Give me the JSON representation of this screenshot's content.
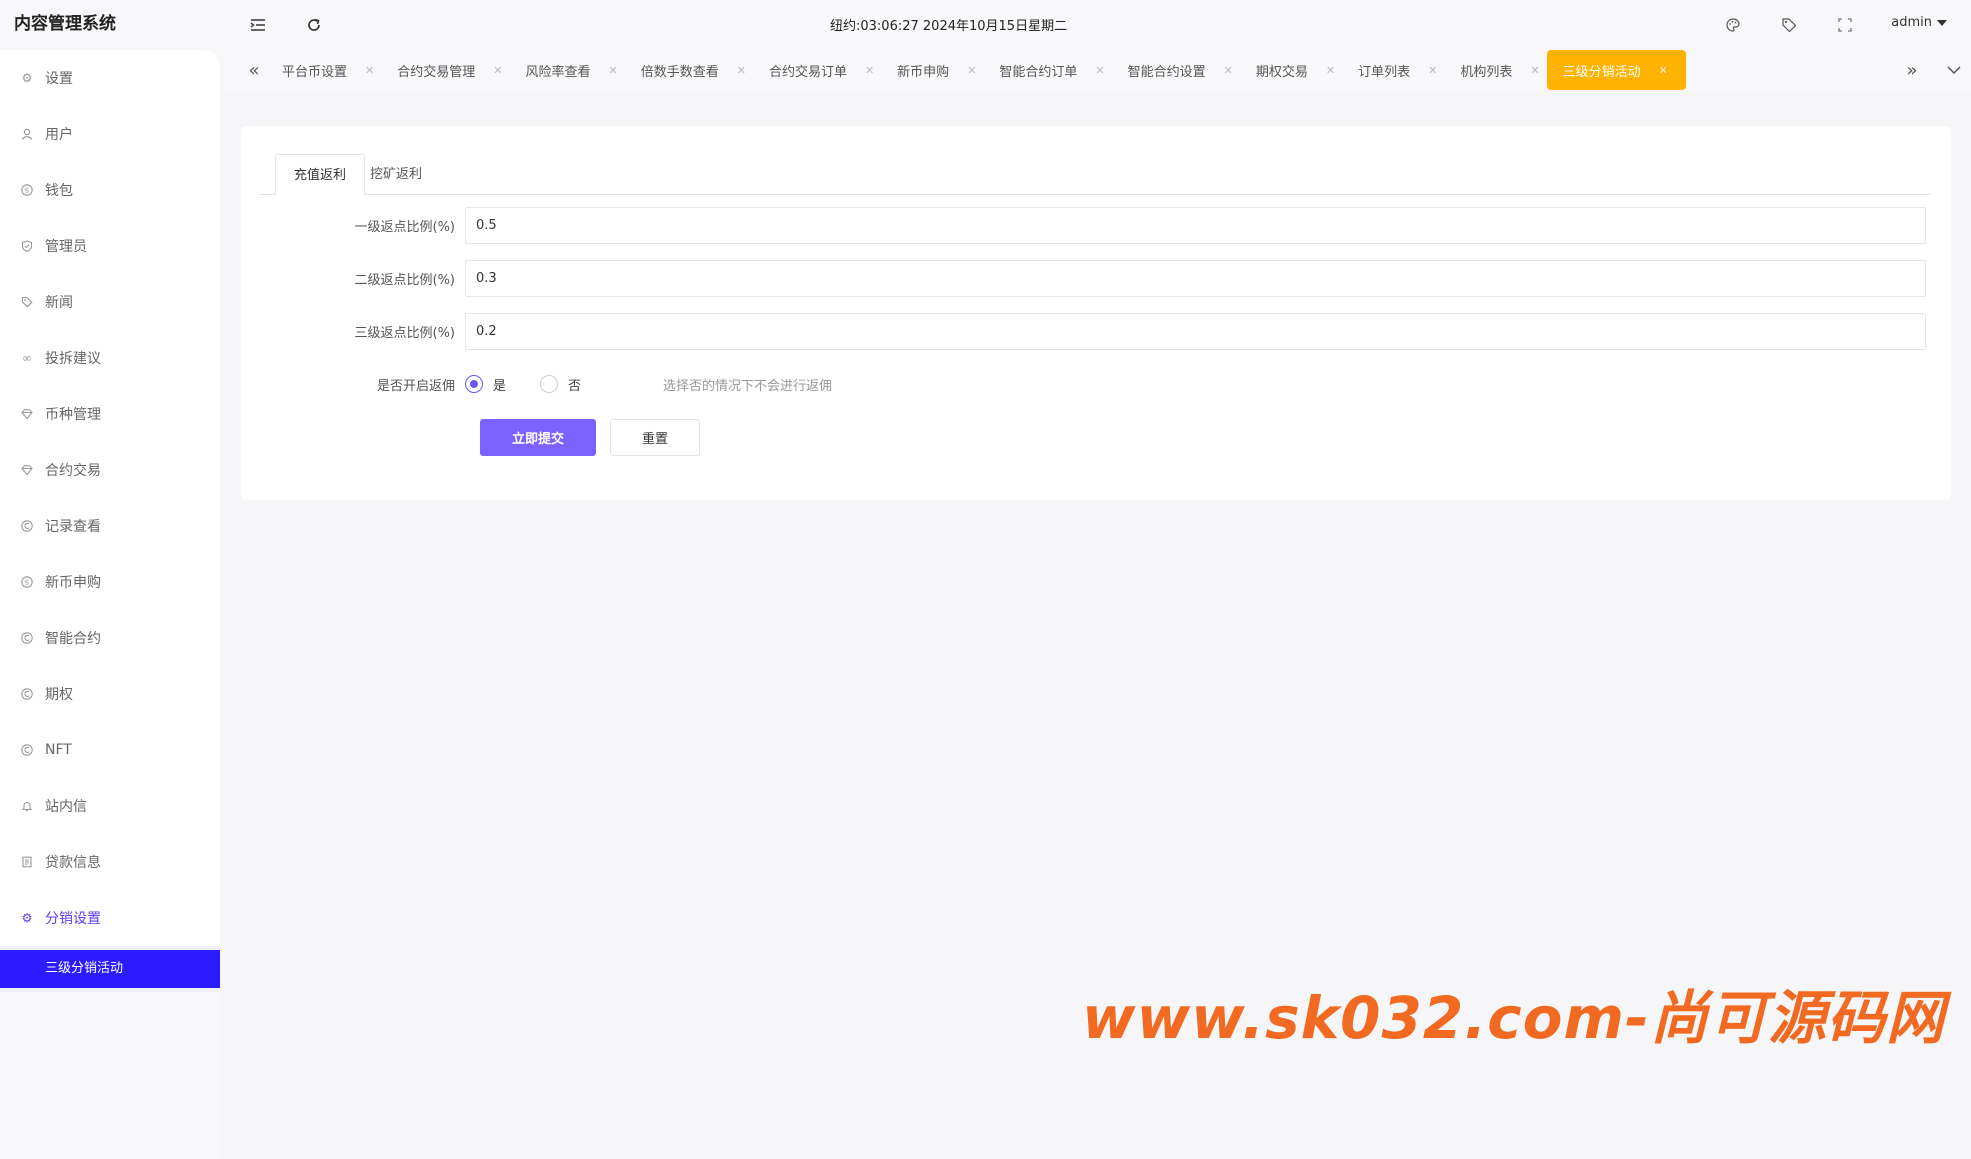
{
  "sidebar": {
    "brand": "内容管理系统",
    "items": [
      {
        "label": "设置",
        "icon": "gear-icon"
      },
      {
        "label": "用户",
        "icon": "user-icon"
      },
      {
        "label": "钱包",
        "icon": "dollar-icon"
      },
      {
        "label": "管理员",
        "icon": "shield-icon"
      },
      {
        "label": "新闻",
        "icon": "tag-icon"
      },
      {
        "label": "投拆建议",
        "icon": "link-icon"
      },
      {
        "label": "币种管理",
        "icon": "diamond-icon"
      },
      {
        "label": "合约交易",
        "icon": "diamond-icon"
      },
      {
        "label": "记录查看",
        "icon": "coin-icon"
      },
      {
        "label": "新币申购",
        "icon": "dollar-icon"
      },
      {
        "label": "智能合约",
        "icon": "coin-icon"
      },
      {
        "label": "期权",
        "icon": "coin-icon"
      },
      {
        "label": "NFT",
        "icon": "coin-icon"
      },
      {
        "label": "站内信",
        "icon": "bell-icon"
      },
      {
        "label": "贷款信息",
        "icon": "document-icon"
      },
      {
        "label": "分销设置",
        "icon": "gear-icon"
      }
    ],
    "submenu_active": "三级分销活动"
  },
  "header": {
    "clock": "纽约:03:06:27 2024年10月15日星期二",
    "user": "admin"
  },
  "tabs": [
    {
      "label": "平台币设置"
    },
    {
      "label": "合约交易管理"
    },
    {
      "label": "风险率查看"
    },
    {
      "label": "倍数手数查看"
    },
    {
      "label": "合约交易订单"
    },
    {
      "label": "新币申购"
    },
    {
      "label": "智能合约订单"
    },
    {
      "label": "智能合约设置"
    },
    {
      "label": "期权交易"
    },
    {
      "label": "订单列表"
    },
    {
      "label": "机构列表"
    },
    {
      "label": "三级分销活动",
      "active": true
    }
  ],
  "card": {
    "inner_tabs": [
      "充值返利",
      "挖矿返利"
    ],
    "fields": [
      {
        "label": "一级返点比例(%)",
        "value": "0.5"
      },
      {
        "label": "二级返点比例(%)",
        "value": "0.3"
      },
      {
        "label": "三级返点比例(%)",
        "value": "0.2"
      }
    ],
    "enable": {
      "label": "是否开启返佣",
      "options": [
        "是",
        "否"
      ],
      "selected": "是",
      "hint": "选择否的情况下不会进行返佣"
    },
    "submit_label": "立即提交",
    "reset_label": "重置"
  },
  "watermark": "www.sk032.com-尚可源码网",
  "colors": {
    "accent": "#7b61ff",
    "active_tab": "#ffb300",
    "active_submenu": "#2d1bff",
    "watermark": "#f26a22"
  }
}
